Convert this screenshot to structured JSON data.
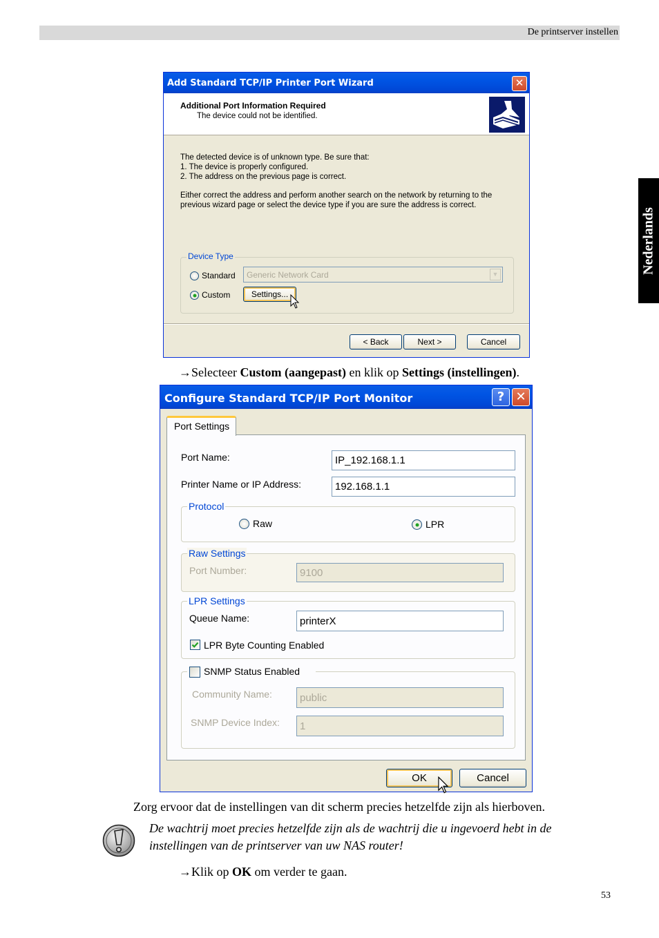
{
  "page": {
    "header_title": "De printserver instellen",
    "language_tab": "Nederlands",
    "page_number": "53"
  },
  "wizard": {
    "title": "Add Standard TCP/IP Printer Port Wizard",
    "header_title": "Additional Port Information Required",
    "header_subtitle": "The device could not be identified.",
    "body_lines": [
      "The detected device is of unknown type.  Be sure that:",
      "1. The device is properly configured.",
      "2.  The address on the previous page is correct."
    ],
    "body_para2_lines": [
      "Either correct the address and perform another search on the network by returning to the",
      "previous wizard page or select the device type if you are sure the address is correct."
    ],
    "device_type": {
      "legend": "Device Type",
      "standard_label": "Standard",
      "standard_selected": false,
      "standard_dropdown_value": "Generic Network Card",
      "custom_label": "Custom",
      "custom_selected": true,
      "settings_button": "Settings..."
    },
    "buttons": {
      "back": "< Back",
      "next": "Next >",
      "cancel": "Cancel"
    }
  },
  "instructions": {
    "step1_prefix": "Selecteer ",
    "step1_bold1": "Custom (aangepast)",
    "step1_mid": " en klik op ",
    "step1_bold2": "Settings (instellingen)",
    "step1_end": ".",
    "paragraph": "Zorg ervoor dat de instellingen van dit scherm precies hetzelfde zijn als hierboven.",
    "note_line1": "De wachtrij moet precies hetzelfde zijn als de wachtrij die u ingevoerd hebt in de",
    "note_line2": "instellingen van de printserver van uw NAS router!",
    "step2_prefix": "Klik op ",
    "step2_bold": "OK",
    "step2_end": " om verder te gaan.",
    "arrow": "→"
  },
  "monitor": {
    "title": "Configure Standard TCP/IP Port Monitor",
    "help_glyph": "?",
    "close_glyph": "✕",
    "tab_label": "Port Settings",
    "port_name_label": "Port Name:",
    "port_name_value": "IP_192.168.1.1",
    "printer_address_label": "Printer Name or IP Address:",
    "printer_address_value": "192.168.1.1",
    "protocol": {
      "legend": "Protocol",
      "raw_label": "Raw",
      "raw_selected": false,
      "lpr_label": "LPR",
      "lpr_selected": true
    },
    "raw_settings": {
      "legend": "Raw Settings",
      "port_number_label": "Port Number:",
      "port_number_value": "9100"
    },
    "lpr_settings": {
      "legend": "LPR Settings",
      "queue_name_label": "Queue Name:",
      "queue_name_value": "printerX",
      "byte_counting_label": "LPR Byte Counting Enabled",
      "byte_counting_checked": true
    },
    "snmp": {
      "enabled_label": "SNMP Status Enabled",
      "enabled_checked": false,
      "community_label": "Community Name:",
      "community_value": "public",
      "device_index_label": "SNMP Device Index:",
      "device_index_value": "1"
    },
    "buttons": {
      "ok": "OK",
      "cancel": "Cancel"
    }
  },
  "colors": {
    "xp_title_blue": "#0054e3",
    "xp_face": "#ece9d8",
    "group_legend_blue": "#0046d5",
    "header_bar_gray": "#d9d9d9"
  }
}
